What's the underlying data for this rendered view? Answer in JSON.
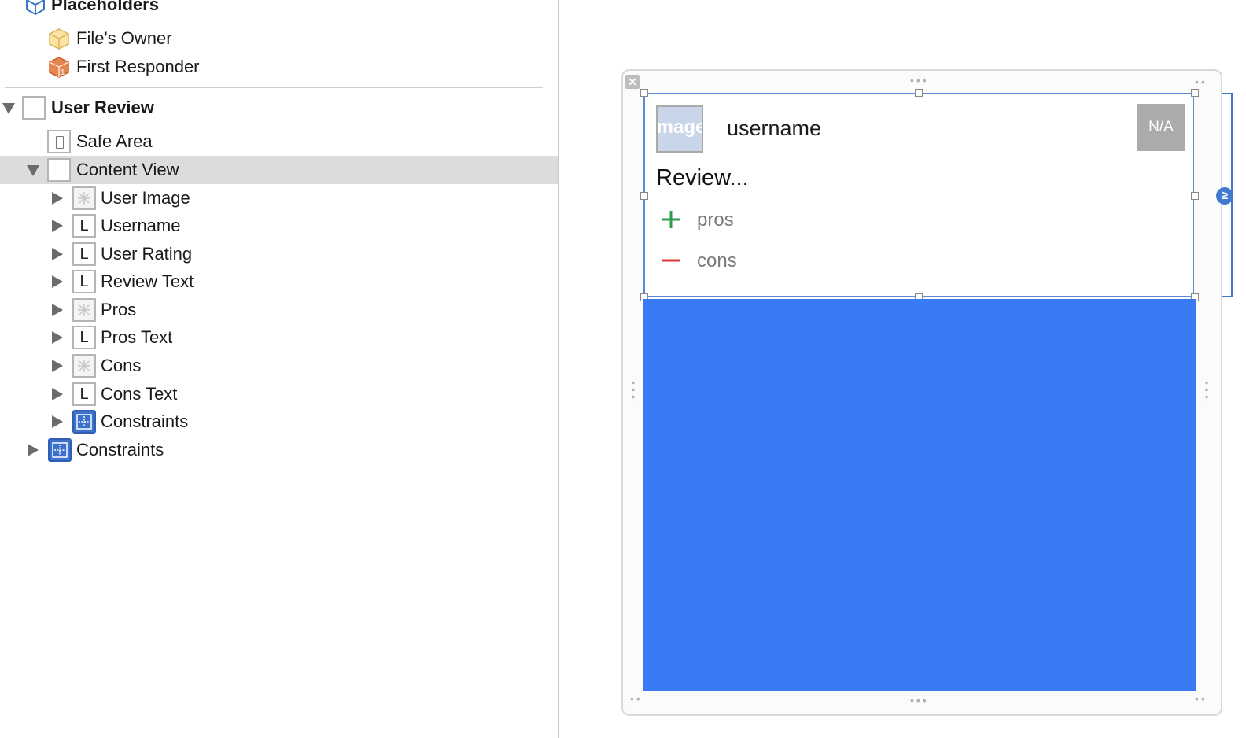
{
  "outline": {
    "placeholders_label": "Placeholders",
    "files_owner_label": "File's Owner",
    "first_responder_label": "First Responder",
    "user_review_label": "User Review",
    "safe_area_label": "Safe Area",
    "content_view_label": "Content View",
    "children": [
      {
        "label": "User Image",
        "icon": "image-view-icon"
      },
      {
        "label": "Username",
        "icon": "label-icon"
      },
      {
        "label": "User Rating",
        "icon": "label-icon"
      },
      {
        "label": "Review Text",
        "icon": "label-icon"
      },
      {
        "label": "Pros",
        "icon": "image-view-icon"
      },
      {
        "label": "Pros Text",
        "icon": "label-icon"
      },
      {
        "label": "Cons",
        "icon": "image-view-icon"
      },
      {
        "label": "Cons Text",
        "icon": "label-icon"
      },
      {
        "label": "Constraints",
        "icon": "constraints-icon"
      }
    ],
    "root_constraints_label": "Constraints",
    "label_icon_glyph": "L"
  },
  "cell": {
    "image_placeholder": "ImageV",
    "username": "username",
    "rating": "N/A",
    "review": "Review...",
    "pros": "pros",
    "cons": "cons"
  },
  "colors": {
    "selection": "#dcdcdc",
    "canvas_view": "#387bf5",
    "pros_accent": "#2e9b4e",
    "cons_accent": "#e0342f"
  }
}
